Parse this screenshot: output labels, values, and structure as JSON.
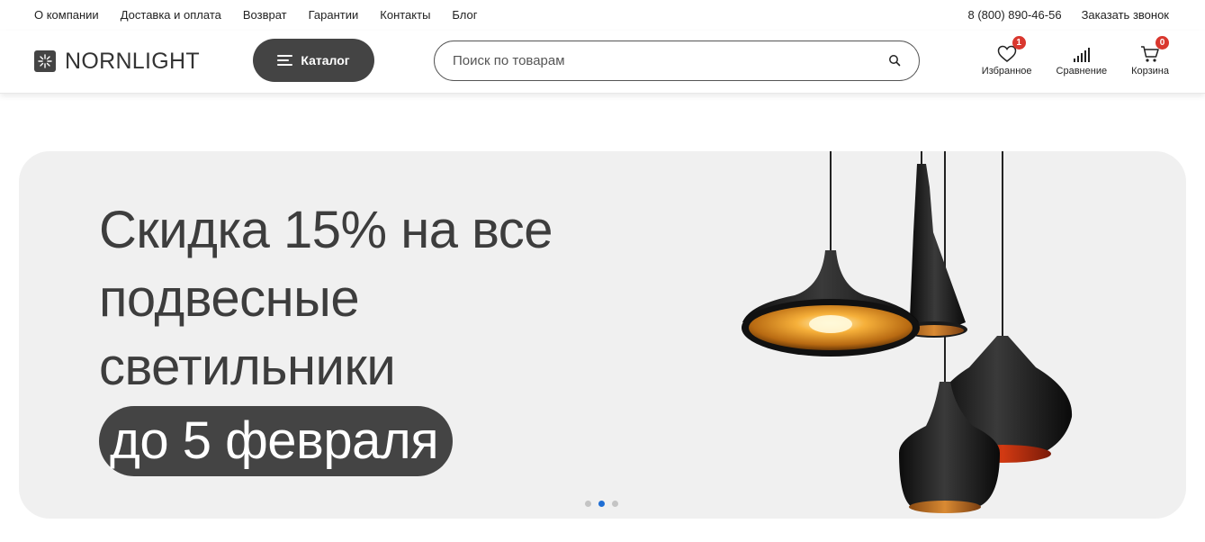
{
  "topnav": {
    "links": [
      "О компании",
      "Доставка и оплата",
      "Возврат",
      "Гарантии",
      "Контакты",
      "Блог"
    ],
    "phone": "8 (800) 890-46-56",
    "callback": "Заказать звонок"
  },
  "header": {
    "logo_text": "NORNLIGHT",
    "catalog_label": "Каталог",
    "search_placeholder": "Поиск по товарам",
    "actions": {
      "favorites": {
        "label": "Избранное",
        "count": "1",
        "icon": "heart-icon"
      },
      "compare": {
        "label": "Сравнение",
        "icon": "bar-chart-icon"
      },
      "cart": {
        "label": "Корзина",
        "count": "0",
        "icon": "cart-icon"
      }
    }
  },
  "banner": {
    "line1": "Скидка 15% на все",
    "line2": "подвесные",
    "line3": "светильники",
    "highlight": "до 5 февраля",
    "slides": 3,
    "active_slide": 2
  },
  "colors": {
    "dark": "#444444",
    "banner_bg": "#f0f0f0",
    "badge": "#d9372e",
    "active_dot": "#1f6ed4"
  }
}
